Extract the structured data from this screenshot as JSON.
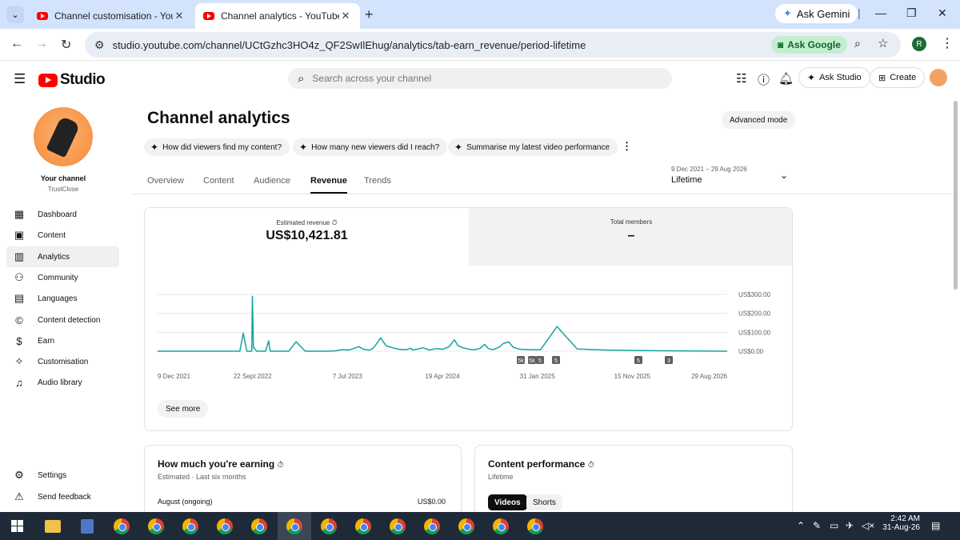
{
  "browser": {
    "tabs": [
      {
        "title": "Channel customisation - YouTub"
      },
      {
        "title": "Channel analytics - YouTube St"
      }
    ],
    "ask_gemini": "Ask Gemini",
    "url": "studio.youtube.com/channel/UCtGzhc3HO4z_QF2SwIlEhug/analytics/tab-earn_revenue/period-lifetime",
    "ask_google": "Ask Google",
    "profile_initial": "R"
  },
  "header": {
    "logo_text": "Studio",
    "search_placeholder": "Search across your channel",
    "ask_studio": "Ask Studio",
    "create": "Create"
  },
  "sidebar": {
    "channel_label": "Your channel",
    "channel_name": "TrustClose",
    "items": [
      {
        "label": "Dashboard",
        "icon": "dashboard-icon"
      },
      {
        "label": "Content",
        "icon": "content-icon"
      },
      {
        "label": "Analytics",
        "icon": "analytics-icon"
      },
      {
        "label": "Community",
        "icon": "community-icon"
      },
      {
        "label": "Languages",
        "icon": "languages-icon"
      },
      {
        "label": "Content detection",
        "icon": "copyright-icon"
      },
      {
        "label": "Earn",
        "icon": "dollar-icon"
      },
      {
        "label": "Customisation",
        "icon": "magic-wand-icon"
      },
      {
        "label": "Audio library",
        "icon": "audio-library-icon"
      }
    ],
    "bottom": [
      {
        "label": "Settings",
        "icon": "gear-icon"
      },
      {
        "label": "Send feedback",
        "icon": "feedback-icon"
      }
    ]
  },
  "main": {
    "title": "Channel analytics",
    "advanced_mode": "Advanced mode",
    "chips": [
      "How did viewers find my content?",
      "How many new viewers did I reach?",
      "Summarise my latest video performance"
    ],
    "tabs": [
      "Overview",
      "Content",
      "Audience",
      "Revenue",
      "Trends"
    ],
    "active_tab": "Revenue",
    "period_range": "9 Dec 2021 – 29 Aug 2026",
    "period_label": "Lifetime",
    "metrics": {
      "estimated_revenue_label": "Estimated revenue",
      "estimated_revenue_value": "US$10,421.81",
      "total_members_label": "Total members",
      "total_members_value": "–"
    },
    "see_more": "See more",
    "earning": {
      "title": "How much you're earning",
      "subtitle": "Estimated · Last six months",
      "row_label": "August (ongoing)",
      "row_value": "US$0.00"
    },
    "performance": {
      "title": "Content performance",
      "subtitle": "Lifetime",
      "tab_videos": "Videos",
      "tab_shorts": "Shorts"
    }
  },
  "chart_data": {
    "type": "line",
    "series": [
      {
        "name": "Estimated revenue",
        "color": "#12a4a0"
      }
    ],
    "x_ticks": [
      "9 Dec 2021",
      "22 Sept 2022",
      "7 Jul 2023",
      "19 Apr 2024",
      "31 Jan 2025",
      "15 Nov 2025",
      "29 Aug 2026"
    ],
    "y_ticks": [
      "US$300.00",
      "US$200.00",
      "US$100.00",
      "US$0.00"
    ],
    "ylim": [
      0,
      300
    ],
    "x": [
      "2021-12-09",
      "2022-01-15",
      "2022-03-01",
      "2022-05-01",
      "2022-07-01",
      "2022-08-05",
      "2022-08-15",
      "2022-08-25",
      "2022-09-05",
      "2022-09-15",
      "2022-09-20",
      "2022-09-22",
      "2022-09-25",
      "2022-10-05",
      "2022-10-20",
      "2022-11-01",
      "2022-11-10",
      "2022-11-15",
      "2022-11-25",
      "2022-12-10",
      "2022-12-20",
      "2023-01-10",
      "2023-02-01",
      "2023-03-01",
      "2023-03-20",
      "2023-04-05",
      "2023-04-20",
      "2023-05-10",
      "2023-06-01",
      "2023-06-20",
      "2023-07-10",
      "2023-07-25",
      "2023-08-10",
      "2023-08-25",
      "2023-09-10",
      "2023-09-20",
      "2023-10-01",
      "2023-10-15",
      "2023-11-01",
      "2023-11-20",
      "2023-12-10",
      "2024-01-01",
      "2024-01-15",
      "2024-01-20",
      "2024-02-01",
      "2024-02-20",
      "2024-03-10",
      "2024-04-01",
      "2024-04-20",
      "2024-05-10",
      "2024-05-25",
      "2024-06-05",
      "2024-06-20",
      "2024-07-10",
      "2024-07-25",
      "2024-08-10",
      "2024-08-25",
      "2024-09-05",
      "2024-09-20",
      "2024-10-01",
      "2024-10-10",
      "2024-10-20",
      "2024-11-05",
      "2024-11-20",
      "2024-12-10",
      "2025-01-10",
      "2025-02-10",
      "2025-04-01",
      "2025-06-01",
      "2025-09-01",
      "2025-12-01",
      "2026-03-01",
      "2026-06-01",
      "2026-08-29"
    ],
    "y": [
      0,
      0,
      0,
      0,
      0,
      0,
      0,
      95,
      0,
      0,
      0,
      290,
      20,
      0,
      0,
      0,
      55,
      0,
      0,
      0,
      0,
      0,
      50,
      0,
      0,
      0,
      0,
      0,
      2,
      8,
      6,
      14,
      24,
      10,
      6,
      12,
      35,
      70,
      28,
      18,
      10,
      8,
      16,
      6,
      10,
      18,
      6,
      14,
      10,
      24,
      60,
      30,
      18,
      10,
      8,
      14,
      36,
      14,
      8,
      16,
      24,
      40,
      50,
      20,
      10,
      8,
      8,
      130,
      12,
      6,
      4,
      2,
      1,
      0
    ],
    "annotations": [
      "5k",
      "5k",
      "5",
      "5",
      "5",
      "3"
    ]
  }
}
